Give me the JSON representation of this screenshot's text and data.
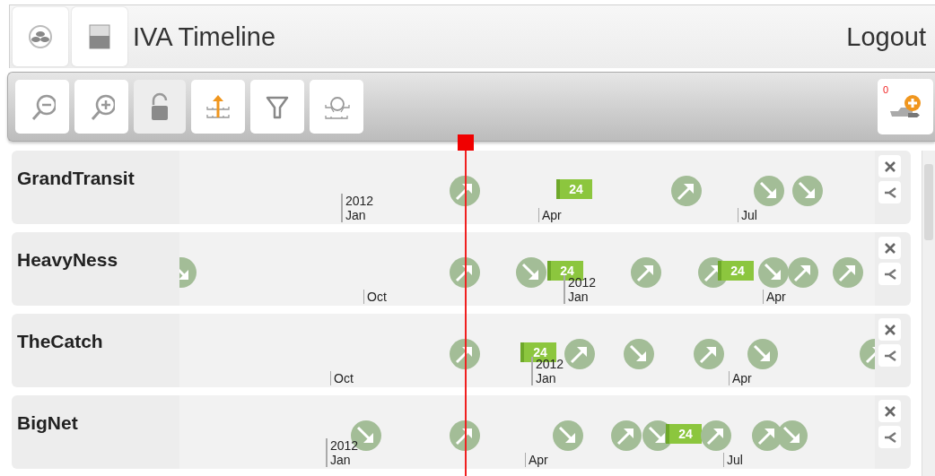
{
  "header": {
    "title": "IVA Timeline",
    "logout": "Logout"
  },
  "toolbar": {
    "buttons": [
      {
        "kind": "zoom-out",
        "pressed": false
      },
      {
        "kind": "zoom-in",
        "pressed": false
      },
      {
        "kind": "lock",
        "pressed": true
      },
      {
        "kind": "raise",
        "pressed": false
      },
      {
        "kind": "filter",
        "pressed": false
      },
      {
        "kind": "lens",
        "pressed": false
      }
    ],
    "queue": {
      "count": "0"
    }
  },
  "tracks": [
    {
      "name": "GrandTransit",
      "ticks": [
        {
          "year": "2012",
          "month": "Jan"
        },
        {
          "month": "Apr"
        },
        {
          "month": "Jul"
        }
      ],
      "events": [
        {
          "kind": "up"
        },
        {
          "kind": "badge",
          "label": "24"
        },
        {
          "kind": "up"
        },
        {
          "kind": "down"
        },
        {
          "kind": "down"
        }
      ]
    },
    {
      "name": "HeavyNess",
      "ticks": [
        {
          "month": "Oct"
        },
        {
          "year": "2012",
          "month": "Jan"
        },
        {
          "month": "Apr"
        }
      ],
      "events": [
        {
          "kind": "down"
        },
        {
          "kind": "up"
        },
        {
          "kind": "down"
        },
        {
          "kind": "badge",
          "label": "24"
        },
        {
          "kind": "up"
        },
        {
          "kind": "up"
        },
        {
          "kind": "badge",
          "label": "24"
        },
        {
          "kind": "down"
        },
        {
          "kind": "up"
        },
        {
          "kind": "up"
        }
      ]
    },
    {
      "name": "TheCatch",
      "ticks": [
        {
          "month": "Oct"
        },
        {
          "year": "2012",
          "month": "Jan"
        },
        {
          "month": "Apr"
        }
      ],
      "events": [
        {
          "kind": "up"
        },
        {
          "kind": "badge",
          "label": "24"
        },
        {
          "kind": "up"
        },
        {
          "kind": "down"
        },
        {
          "kind": "up"
        },
        {
          "kind": "down"
        },
        {
          "kind": "up"
        }
      ]
    },
    {
      "name": "BigNet",
      "ticks": [
        {
          "year": "2012",
          "month": "Jan"
        },
        {
          "month": "Apr"
        },
        {
          "month": "Jul"
        }
      ],
      "events": [
        {
          "kind": "down"
        },
        {
          "kind": "up"
        },
        {
          "kind": "down"
        },
        {
          "kind": "up"
        },
        {
          "kind": "down"
        },
        {
          "kind": "badge",
          "label": "24"
        },
        {
          "kind": "up"
        },
        {
          "kind": "up"
        },
        {
          "kind": "down"
        }
      ]
    }
  ]
}
